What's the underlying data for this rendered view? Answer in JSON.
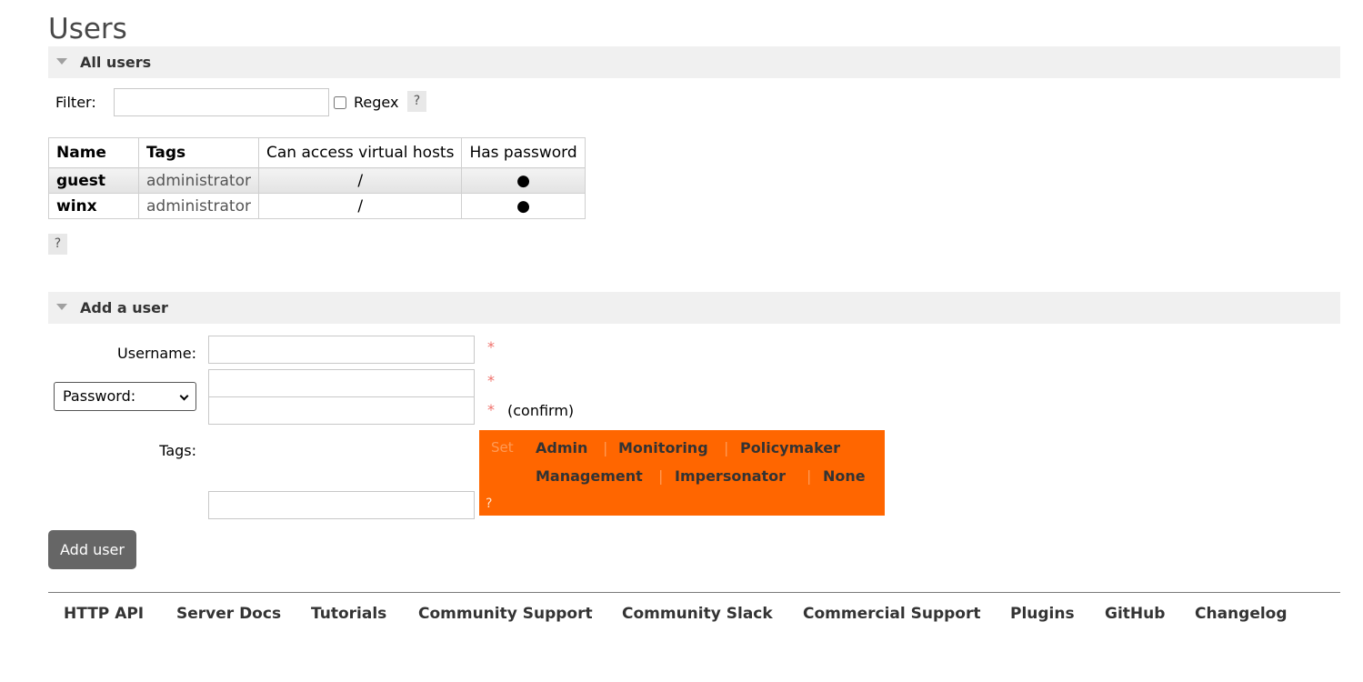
{
  "page": {
    "title": "Users"
  },
  "all_users": {
    "header": "All users",
    "filter_label": "Filter:",
    "filter_value": "",
    "regex_label": "Regex",
    "regex_checked": false,
    "help_label": "?",
    "table": {
      "columns": [
        "Name",
        "Tags",
        "Can access virtual hosts",
        "Has password"
      ],
      "rows": [
        {
          "name": "guest",
          "tags": "administrator",
          "vhosts": "/",
          "has_password": "●"
        },
        {
          "name": "winx",
          "tags": "administrator",
          "vhosts": "/",
          "has_password": "●"
        }
      ]
    },
    "table_help_label": "?"
  },
  "add_user": {
    "header": "Add a user",
    "username_label": "Username:",
    "username_value": "",
    "password_select": "Password:",
    "password_value": "",
    "password_confirm_value": "",
    "required_mark": "*",
    "confirm_label": "(confirm)",
    "tags_label": "Tags:",
    "tags_value": "",
    "tag_panel": {
      "set_label": "Set",
      "tags": [
        "Admin",
        "Monitoring",
        "Policymaker",
        "Management",
        "Impersonator",
        "None"
      ],
      "separator": "|",
      "help_label": "?",
      "background_color": "#ff6600"
    },
    "submit_label": "Add user"
  },
  "footer": {
    "links": [
      "HTTP API",
      "Server Docs",
      "Tutorials",
      "Community Support",
      "Community Slack",
      "Commercial Support",
      "Plugins",
      "GitHub",
      "Changelog"
    ]
  },
  "colors": {
    "accent": "#ff6600",
    "section_header_bg": "#f0f0f0",
    "button_bg": "#666666",
    "required": "#f0706a"
  },
  "icons": {
    "section_toggle": "triangle-down-icon",
    "select_chevron": "chevron-down-icon"
  }
}
